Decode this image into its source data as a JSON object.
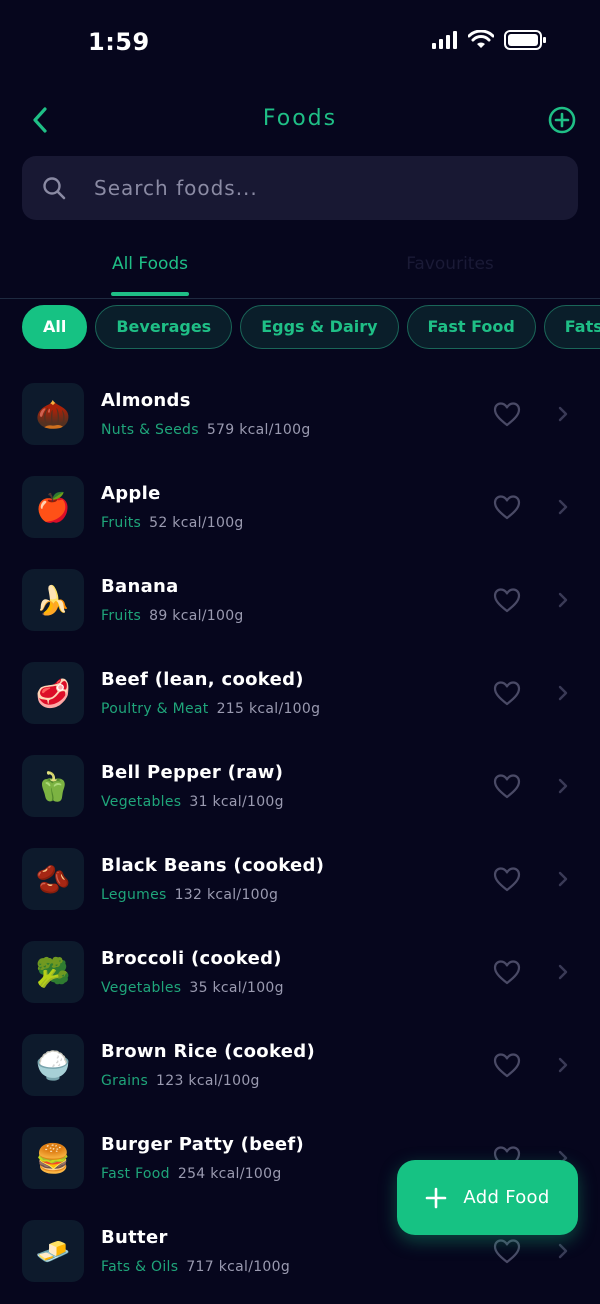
{
  "status_bar": {
    "time": "1:59",
    "icons": [
      "cellular-signal-icon",
      "wifi-icon",
      "battery-icon"
    ]
  },
  "nav": {
    "back_icon": "chevron-left-icon",
    "title": "Foods",
    "add_icon": "plus-circle-icon"
  },
  "search": {
    "placeholder": "Search foods...",
    "value": "",
    "icon": "search-icon"
  },
  "tabs": [
    {
      "label": "All Foods",
      "active": true
    },
    {
      "label": "Favourites",
      "active": false
    }
  ],
  "chips": [
    {
      "label": "All",
      "active": true
    },
    {
      "label": "Beverages",
      "active": false
    },
    {
      "label": "Eggs & Dairy",
      "active": false
    },
    {
      "label": "Fast Food",
      "active": false
    },
    {
      "label": "Fats &",
      "active": false
    }
  ],
  "foods": [
    {
      "name": "Almonds",
      "category": "Nuts & Seeds",
      "kcal": "579 kcal/100g",
      "icon": "🌰"
    },
    {
      "name": "Apple",
      "category": "Fruits",
      "kcal": "52 kcal/100g",
      "icon": "🍎"
    },
    {
      "name": "Banana",
      "category": "Fruits",
      "kcal": "89 kcal/100g",
      "icon": "🍌"
    },
    {
      "name": "Beef (lean, cooked)",
      "category": "Poultry & Meat",
      "kcal": "215 kcal/100g",
      "icon": "🥩"
    },
    {
      "name": "Bell Pepper (raw)",
      "category": "Vegetables",
      "kcal": "31 kcal/100g",
      "icon": "🫑"
    },
    {
      "name": "Black Beans (cooked)",
      "category": "Legumes",
      "kcal": "132 kcal/100g",
      "icon": "🫘"
    },
    {
      "name": "Broccoli (cooked)",
      "category": "Vegetables",
      "kcal": "35 kcal/100g",
      "icon": "🥦"
    },
    {
      "name": "Brown Rice (cooked)",
      "category": "Grains",
      "kcal": "123 kcal/100g",
      "icon": "🍚"
    },
    {
      "name": "Burger Patty (beef)",
      "category": "Fast Food",
      "kcal": "254 kcal/100g",
      "icon": "🍔"
    },
    {
      "name": "Butter",
      "category": "Fats & Oils",
      "kcal": "717 kcal/100g",
      "icon": "🧈"
    }
  ],
  "fab": {
    "label": "Add Food",
    "icon": "plus-icon"
  },
  "colors": {
    "background": "#06061d",
    "accent": "#16c283",
    "accent_text": "#1fbf86",
    "surface": "#181833",
    "muted_text": "#9a9ab0"
  }
}
